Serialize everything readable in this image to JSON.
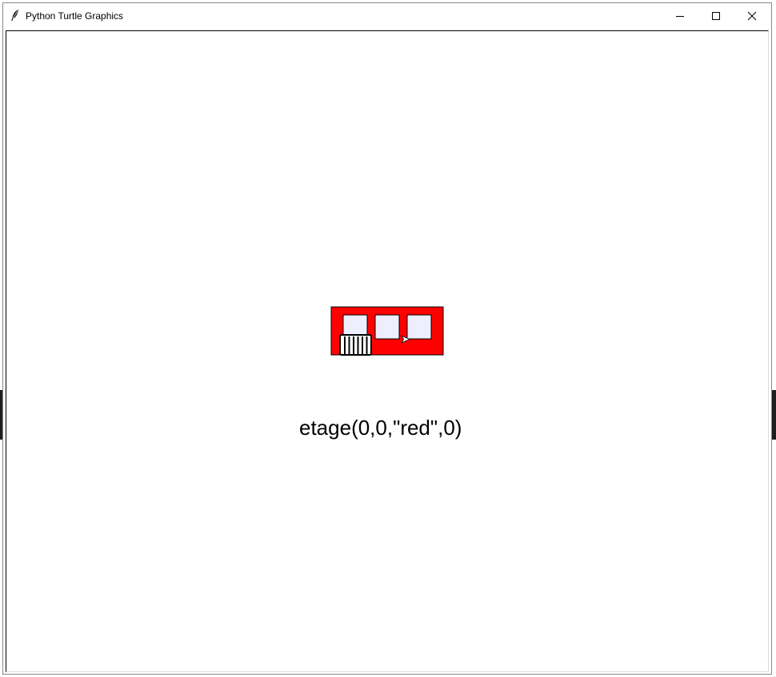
{
  "window": {
    "title": "Python Turtle Graphics"
  },
  "titlebar_buttons": {
    "minimize_icon": "minimize-icon",
    "maximize_icon": "maximize-icon",
    "close_icon": "close-icon"
  },
  "canvas": {
    "label_text": "etage(0,0,\"red\",0)",
    "building": {
      "wall_color": "#ff0000",
      "window_color": "#eeeeff",
      "door_color": "#ffffff",
      "outline_color": "#000000",
      "window_count": 3
    },
    "turtle_icon": "turtle-arrow-icon"
  }
}
